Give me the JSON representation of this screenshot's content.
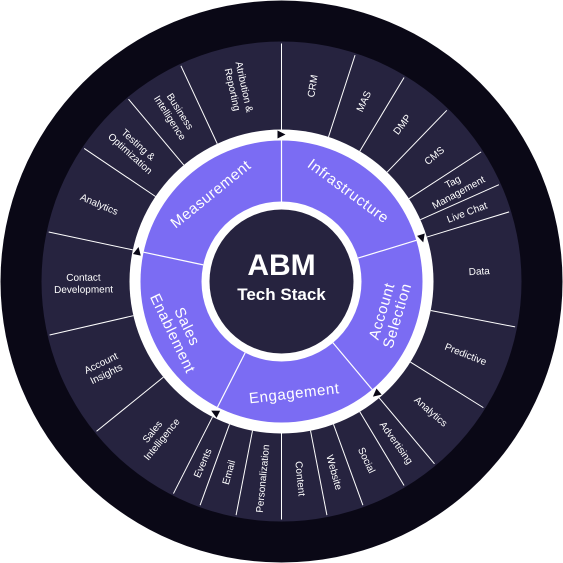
{
  "center": {
    "title": "ABM",
    "subtitle": "Tech Stack"
  },
  "colors": {
    "outer_ring": "#26233f",
    "outer_border": "#0a0816",
    "white_band": "#ffffff",
    "inner_ring": "#7b6cf3",
    "center_disc": "#26233f",
    "divider": "#ffffff"
  },
  "categories": [
    {
      "id": "infrastructure",
      "label": "Infrastructure",
      "items": [
        "CRM",
        "MAS",
        "DMP",
        "CMS",
        "Tag\nManagement",
        "Live Chat"
      ]
    },
    {
      "id": "account-selection",
      "label": "Account\nSelection",
      "items": [
        "Data",
        "Predictive",
        "Analytics"
      ]
    },
    {
      "id": "engagement",
      "label": "Engagement",
      "items": [
        "Advertising",
        "Social",
        "Website",
        "Content",
        "Personalization",
        "Email",
        "Events"
      ]
    },
    {
      "id": "sales-enablement",
      "label": "Sales\nEnablement",
      "items": [
        "Sales\nIntelligence",
        "Account\nInsights",
        "Contact\nDevelopment"
      ]
    },
    {
      "id": "measurement",
      "label": "Measurement",
      "items": [
        "Analytics",
        "Testing &\nOptimization",
        "Business\nIntelligence",
        "Atribution &\nReporting"
      ]
    }
  ]
}
